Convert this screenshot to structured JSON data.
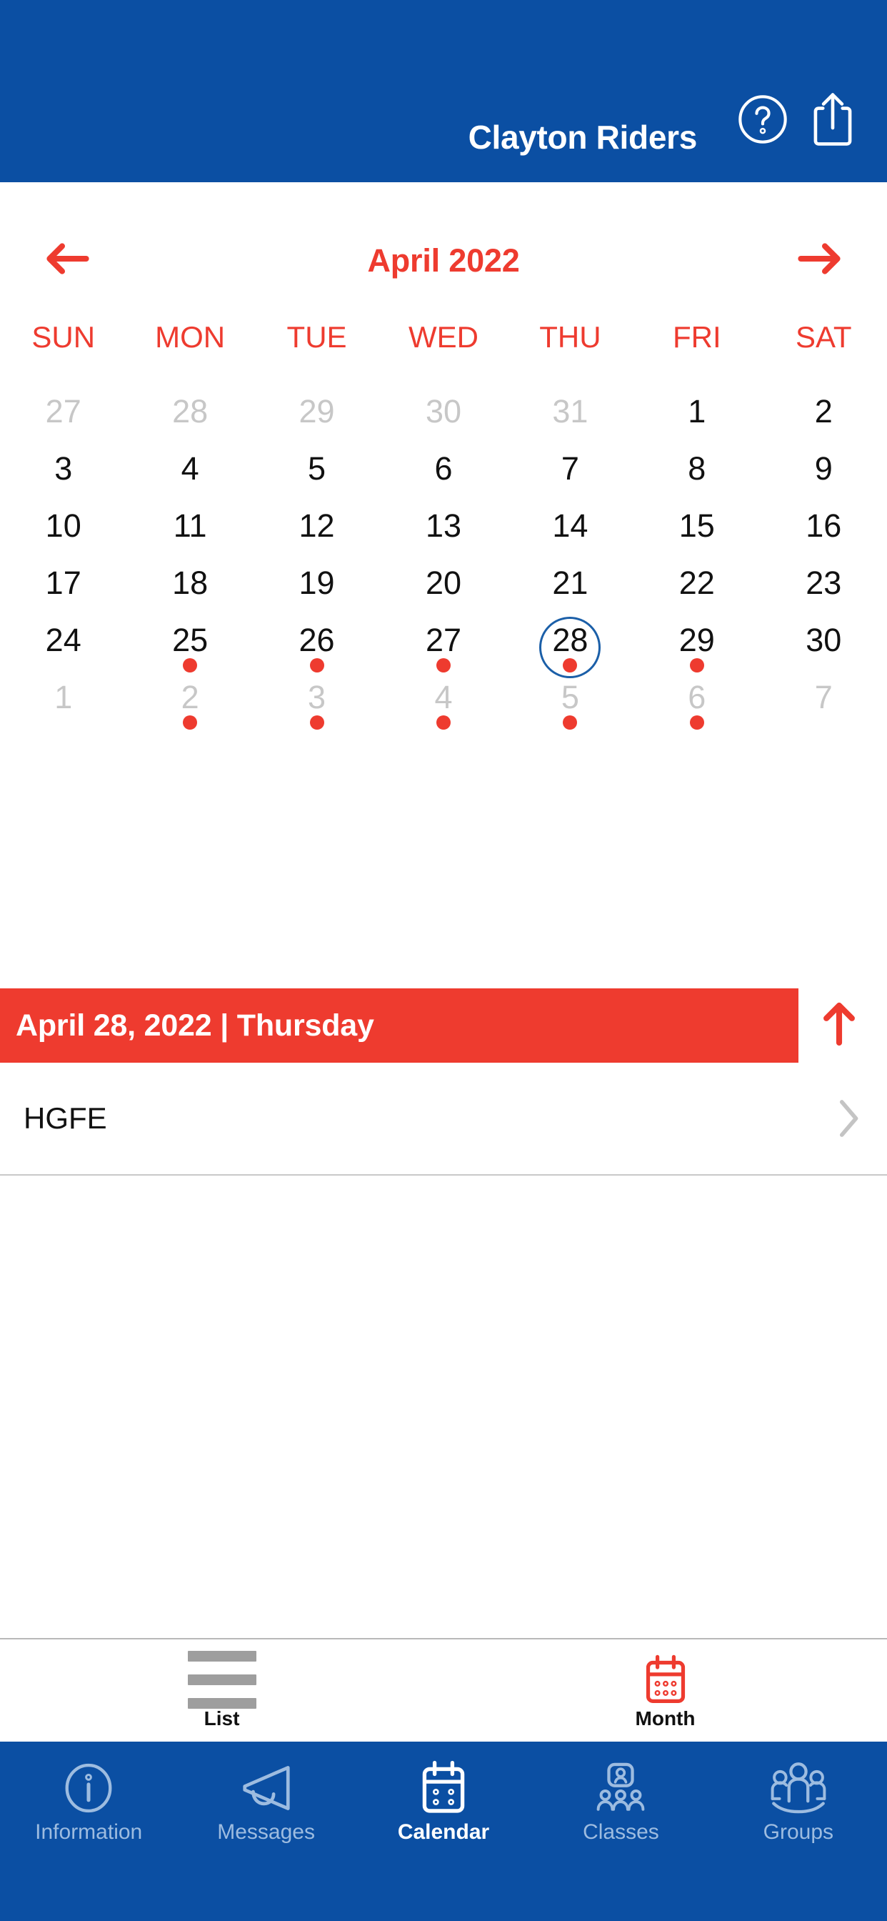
{
  "header": {
    "title": "Clayton Riders",
    "help_icon": "help-circle-icon",
    "share_icon": "share-icon",
    "background_color": "#0B4FA3"
  },
  "month_nav": {
    "prev_icon": "arrow-left-icon",
    "next_icon": "arrow-right-icon",
    "month_label": "April 2022",
    "accent_color": "#EE3B2F"
  },
  "calendar": {
    "weekdays": [
      "SUN",
      "MON",
      "TUE",
      "WED",
      "THU",
      "FRI",
      "SAT"
    ],
    "selected_day": 28,
    "selected_ring_color": "#1B5FA8",
    "event_dot_color": "#EE3B2F",
    "weeks": [
      [
        {
          "label": "27",
          "muted": true,
          "dot": false,
          "selected": false
        },
        {
          "label": "28",
          "muted": true,
          "dot": false,
          "selected": false
        },
        {
          "label": "29",
          "muted": true,
          "dot": false,
          "selected": false
        },
        {
          "label": "30",
          "muted": true,
          "dot": false,
          "selected": false
        },
        {
          "label": "31",
          "muted": true,
          "dot": false,
          "selected": false
        },
        {
          "label": "1",
          "muted": false,
          "dot": false,
          "selected": false
        },
        {
          "label": "2",
          "muted": false,
          "dot": false,
          "selected": false
        }
      ],
      [
        {
          "label": "3",
          "muted": false,
          "dot": false,
          "selected": false
        },
        {
          "label": "4",
          "muted": false,
          "dot": false,
          "selected": false
        },
        {
          "label": "5",
          "muted": false,
          "dot": false,
          "selected": false
        },
        {
          "label": "6",
          "muted": false,
          "dot": false,
          "selected": false
        },
        {
          "label": "7",
          "muted": false,
          "dot": false,
          "selected": false
        },
        {
          "label": "8",
          "muted": false,
          "dot": false,
          "selected": false
        },
        {
          "label": "9",
          "muted": false,
          "dot": false,
          "selected": false
        }
      ],
      [
        {
          "label": "10",
          "muted": false,
          "dot": false,
          "selected": false
        },
        {
          "label": "11",
          "muted": false,
          "dot": false,
          "selected": false
        },
        {
          "label": "12",
          "muted": false,
          "dot": false,
          "selected": false
        },
        {
          "label": "13",
          "muted": false,
          "dot": false,
          "selected": false
        },
        {
          "label": "14",
          "muted": false,
          "dot": false,
          "selected": false
        },
        {
          "label": "15",
          "muted": false,
          "dot": false,
          "selected": false
        },
        {
          "label": "16",
          "muted": false,
          "dot": false,
          "selected": false
        }
      ],
      [
        {
          "label": "17",
          "muted": false,
          "dot": false,
          "selected": false
        },
        {
          "label": "18",
          "muted": false,
          "dot": false,
          "selected": false
        },
        {
          "label": "19",
          "muted": false,
          "dot": false,
          "selected": false
        },
        {
          "label": "20",
          "muted": false,
          "dot": false,
          "selected": false
        },
        {
          "label": "21",
          "muted": false,
          "dot": false,
          "selected": false
        },
        {
          "label": "22",
          "muted": false,
          "dot": false,
          "selected": false
        },
        {
          "label": "23",
          "muted": false,
          "dot": false,
          "selected": false
        }
      ],
      [
        {
          "label": "24",
          "muted": false,
          "dot": false,
          "selected": false
        },
        {
          "label": "25",
          "muted": false,
          "dot": true,
          "selected": false
        },
        {
          "label": "26",
          "muted": false,
          "dot": true,
          "selected": false
        },
        {
          "label": "27",
          "muted": false,
          "dot": true,
          "selected": false
        },
        {
          "label": "28",
          "muted": false,
          "dot": true,
          "selected": true
        },
        {
          "label": "29",
          "muted": false,
          "dot": true,
          "selected": false
        },
        {
          "label": "30",
          "muted": false,
          "dot": false,
          "selected": false
        }
      ],
      [
        {
          "label": "1",
          "muted": true,
          "dot": false,
          "selected": false
        },
        {
          "label": "2",
          "muted": true,
          "dot": true,
          "selected": false
        },
        {
          "label": "3",
          "muted": true,
          "dot": true,
          "selected": false
        },
        {
          "label": "4",
          "muted": true,
          "dot": true,
          "selected": false
        },
        {
          "label": "5",
          "muted": true,
          "dot": true,
          "selected": false
        },
        {
          "label": "6",
          "muted": true,
          "dot": true,
          "selected": false
        },
        {
          "label": "7",
          "muted": true,
          "dot": false,
          "selected": false
        }
      ]
    ]
  },
  "date_banner": {
    "text": "April 28, 2022 | Thursday",
    "background_color": "#EE3B2F",
    "collapse_icon": "arrow-up-icon"
  },
  "events": [
    {
      "title": "HGFE",
      "chevron_icon": "chevron-right-icon"
    }
  ],
  "view_toggle": {
    "items": [
      {
        "label": "List",
        "icon": "list-icon",
        "active": false
      },
      {
        "label": "Month",
        "icon": "calendar-icon",
        "active": true
      }
    ],
    "active_color": "#EE3B2F",
    "inactive_color": "#9e9e9e"
  },
  "tab_bar": {
    "items": [
      {
        "label": "Information",
        "icon": "info-circle-icon",
        "active": false
      },
      {
        "label": "Messages",
        "icon": "megaphone-icon",
        "active": false
      },
      {
        "label": "Calendar",
        "icon": "calendar-icon",
        "active": true
      },
      {
        "label": "Classes",
        "icon": "classroom-icon",
        "active": false
      },
      {
        "label": "Groups",
        "icon": "people-group-icon",
        "active": false
      }
    ],
    "background_color": "#0B4FA3",
    "active_color": "#ffffff",
    "inactive_color": "#9DBCE0"
  }
}
